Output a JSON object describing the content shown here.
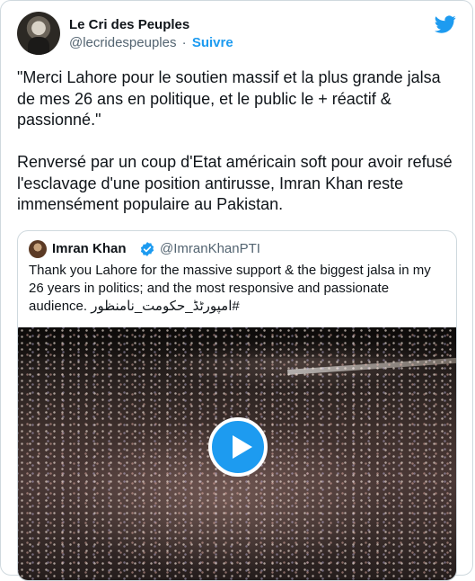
{
  "author": {
    "name": "Le Cri des Peuples",
    "handle": "@lecridespeuples",
    "separator": "·",
    "follow_label": "Suivre"
  },
  "tweet": {
    "text": "\"Merci Lahore pour le soutien massif et la plus grande jalsa de mes 26 ans en politique, et le public le + réactif & passionné.\"\n\nRenversé par un coup d'Etat américain soft pour avoir refusé l'esclavage d'une position antirusse, Imran Khan reste immensément populaire au Pakistan."
  },
  "quoted_tweet": {
    "name": "Imran Khan",
    "handle": "@ImranKhanPTI",
    "text": "Thank you Lahore for the massive support & the biggest jalsa in my 26 years in politics; and the most responsive and passionate audience.",
    "hashtag": "#امپورٹڈ_حکومت_نامنظور"
  },
  "colors": {
    "accent": "#1d9bf0",
    "border": "#cfd9de",
    "secondary_text": "#536471"
  },
  "icons": {
    "brand": "twitter-bird-icon",
    "verified": "verified-badge-icon",
    "play": "play-icon"
  }
}
